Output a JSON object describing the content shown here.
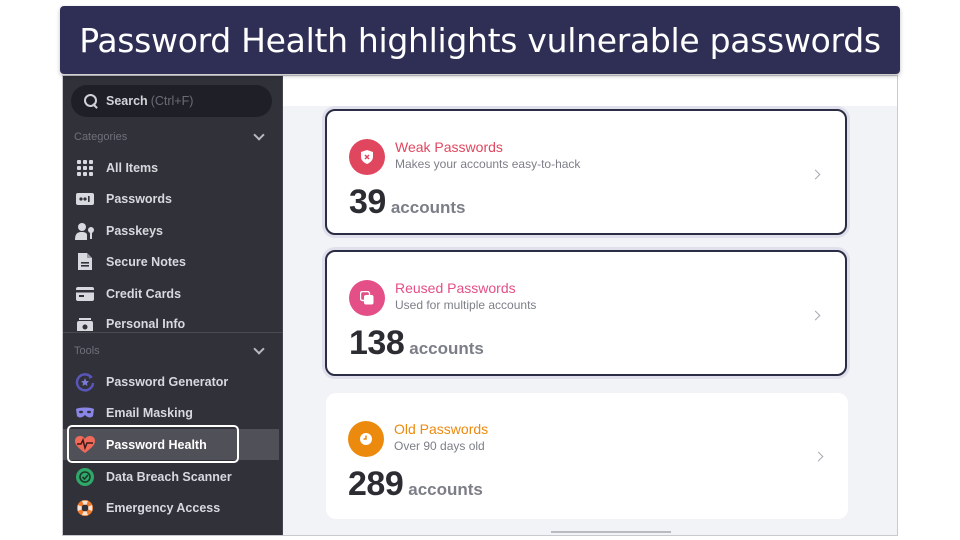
{
  "banner": {
    "title": "Password Health highlights vulnerable passwords"
  },
  "sidebar": {
    "search": {
      "label": "Search",
      "shortcut": "(Ctrl+F)"
    },
    "categories": {
      "heading": "Categories",
      "items": [
        {
          "label": "All Items",
          "icon": "grid-icon"
        },
        {
          "label": "Passwords",
          "icon": "password-icon"
        },
        {
          "label": "Passkeys",
          "icon": "passkey-icon"
        },
        {
          "label": "Secure Notes",
          "icon": "note-icon"
        },
        {
          "label": "Credit Cards",
          "icon": "credit-card-icon"
        },
        {
          "label": "Personal Info",
          "icon": "personal-info-icon"
        }
      ]
    },
    "tools": {
      "heading": "Tools",
      "items": [
        {
          "label": "Password Generator",
          "icon": "generator-icon"
        },
        {
          "label": "Email Masking",
          "icon": "mask-icon"
        },
        {
          "label": "Password Health",
          "icon": "heart-pulse-icon",
          "active": true
        },
        {
          "label": "Data Breach Scanner",
          "icon": "scanner-icon"
        },
        {
          "label": "Emergency Access",
          "icon": "lifebuoy-icon"
        }
      ]
    }
  },
  "main": {
    "cards": [
      {
        "title": "Weak Passwords",
        "subtitle": "Makes your accounts easy-to-hack",
        "count": "39",
        "unit": "accounts",
        "color": "#e0475f",
        "icon": "shield-x-icon"
      },
      {
        "title": "Reused Passwords",
        "subtitle": "Used for multiple accounts",
        "count": "138",
        "unit": "accounts",
        "color": "#e34f86",
        "icon": "copy-icon"
      },
      {
        "title": "Old Passwords",
        "subtitle": "Over 90 days old",
        "count": "289",
        "unit": "accounts",
        "color": "#ec8a0e",
        "icon": "clock-icon"
      }
    ]
  }
}
